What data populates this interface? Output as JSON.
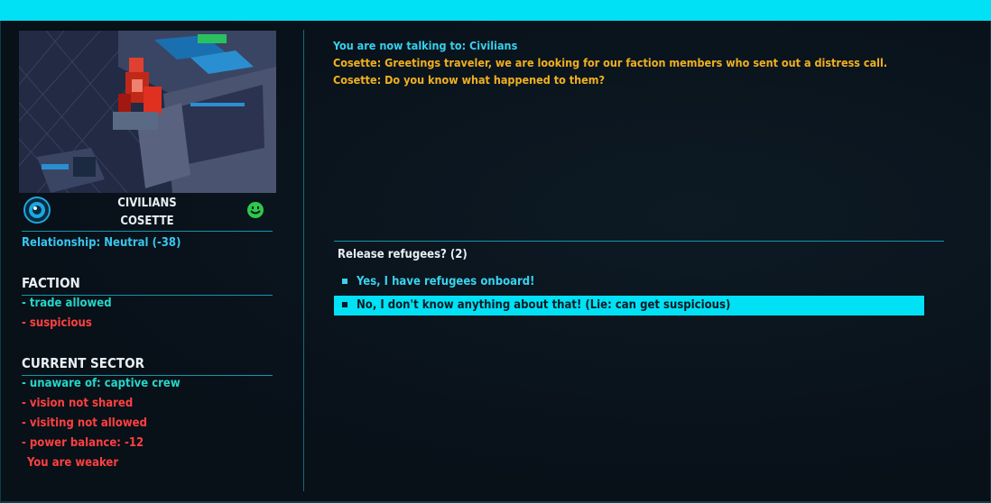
{
  "colors": {
    "accent": "#00e1f5",
    "positive": "#25d6c9",
    "negative": "#ff4040",
    "npc_text": "#f0b020",
    "system_text": "#36d0ec"
  },
  "character": {
    "faction": "CIVILIANS",
    "name": "COSETTE",
    "faction_icon": "civilians-faction-icon",
    "mood_icon": "smiley-face-icon",
    "relationship": "Relationship: Neutral (-38)"
  },
  "faction_section": {
    "title": "FACTION",
    "traits": [
      {
        "text": "- trade allowed",
        "status": "positive"
      },
      {
        "text": "- suspicious",
        "status": "negative"
      }
    ]
  },
  "sector_section": {
    "title": "CURRENT SECTOR",
    "traits": [
      {
        "text": "- unaware of: captive crew",
        "status": "positive"
      },
      {
        "text": "- vision not shared",
        "status": "negative"
      },
      {
        "text": "- visiting not allowed",
        "status": "negative"
      },
      {
        "text": "- power balance: -12",
        "status": "negative"
      },
      {
        "text": "You are weaker",
        "status": "negative"
      }
    ]
  },
  "dialogue": {
    "log": [
      {
        "speaker": "system",
        "text": "You are now talking to: Civilians"
      },
      {
        "speaker": "npc",
        "text": "Cosette: Greetings traveler, we are looking for our faction members who sent out a distress call."
      },
      {
        "speaker": "npc",
        "text": "Cosette: Do you know what happened to them?"
      }
    ],
    "prompt": "Release refugees? (2)",
    "options": [
      {
        "label": "Yes, I have refugees onboard!"
      },
      {
        "label": "No, I don't know anything about that! (Lie: can get suspicious)",
        "selected": true
      }
    ]
  }
}
